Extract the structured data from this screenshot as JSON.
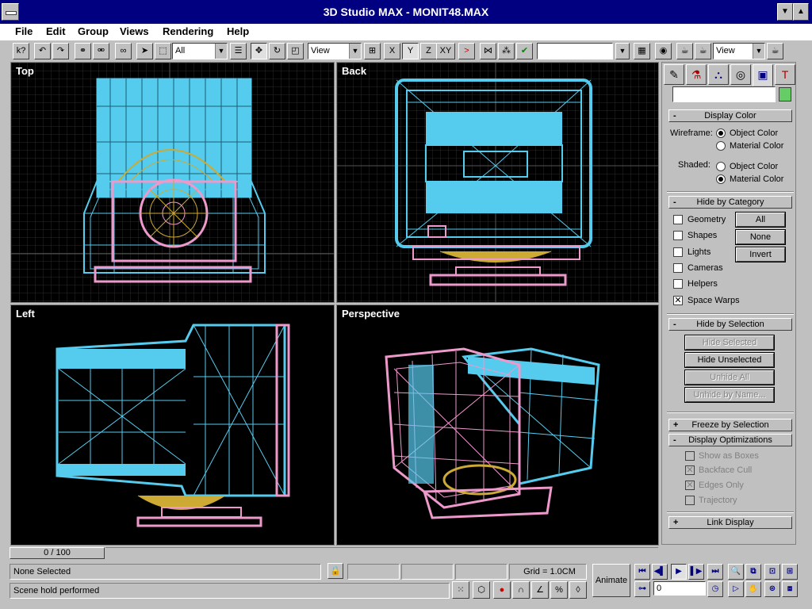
{
  "window": {
    "title": "3D Studio MAX - MONIT48.MAX",
    "title_bar_color": "#000080"
  },
  "menu": [
    "File",
    "Edit",
    "Group",
    "Views",
    "Rendering",
    "Help"
  ],
  "toolbar": {
    "icons": [
      "help-pointer-icon",
      "undo-icon",
      "redo-icon",
      "link-icon",
      "unlink-icon",
      "bind-spacewarp-icon",
      "select-icon",
      "region-select-icon"
    ],
    "selection_filter": "All",
    "transform_icons": [
      "select-by-name-icon",
      "move-icon",
      "rotate-icon",
      "scale-icon"
    ],
    "coord_system": "View",
    "axis_buttons": [
      "X",
      "Y",
      "Z",
      "XY"
    ],
    "active_axis": "Y",
    "named_selection": "",
    "render_view": "View"
  },
  "viewports": {
    "top": {
      "label": "Top"
    },
    "back": {
      "label": "Back"
    },
    "left": {
      "label": "Left"
    },
    "perspective": {
      "label": "Perspective"
    },
    "wire_colors": {
      "cyan": "#55ccee",
      "pink": "#ee99cc",
      "gold": "#ccaa33"
    }
  },
  "command_panel": {
    "tab_icons": [
      "create-icon",
      "modify-icon",
      "hierarchy-icon",
      "motion-icon",
      "display-icon",
      "utilities-icon"
    ],
    "active_tab": "display-icon",
    "object_name": "",
    "object_color": "#66cc66",
    "display_color": {
      "title": "Display Color",
      "wireframe_label": "Wireframe:",
      "shaded_label": "Shaded:",
      "object_color": "Object Color",
      "material_color": "Material Color",
      "wireframe_selected": "Object Color",
      "shaded_selected": "Material Color"
    },
    "hide_by_category": {
      "title": "Hide by Category",
      "items": [
        {
          "label": "Geometry",
          "checked": false
        },
        {
          "label": "Shapes",
          "checked": false
        },
        {
          "label": "Lights",
          "checked": false
        },
        {
          "label": "Cameras",
          "checked": false
        },
        {
          "label": "Helpers",
          "checked": false
        },
        {
          "label": "Space Warps",
          "checked": true
        }
      ],
      "buttons": [
        "All",
        "None",
        "Invert"
      ]
    },
    "hide_by_selection": {
      "title": "Hide by Selection",
      "buttons": [
        {
          "label": "Hide Selected",
          "enabled": false
        },
        {
          "label": "Hide Unselected",
          "enabled": true
        },
        {
          "label": "Unhide All",
          "enabled": false
        },
        {
          "label": "Unhide by Name...",
          "enabled": false
        }
      ]
    },
    "freeze_by_selection": {
      "title": "Freeze by Selection",
      "sign": "+"
    },
    "display_optimizations": {
      "title": "Display Optimizations",
      "items": [
        {
          "label": "Show as Boxes",
          "checked": false
        },
        {
          "label": "Backface Cull",
          "checked": true
        },
        {
          "label": "Edges Only",
          "checked": true
        },
        {
          "label": "Trajectory",
          "checked": false
        }
      ]
    },
    "link_display": {
      "title": "Link Display",
      "sign": "+"
    }
  },
  "status": {
    "frame_slider": "0 / 100",
    "selection": "None Selected",
    "prompt": "Scene hold performed",
    "grid": "Grid = 1.0CM",
    "animate": "Animate",
    "current_frame": "0"
  }
}
